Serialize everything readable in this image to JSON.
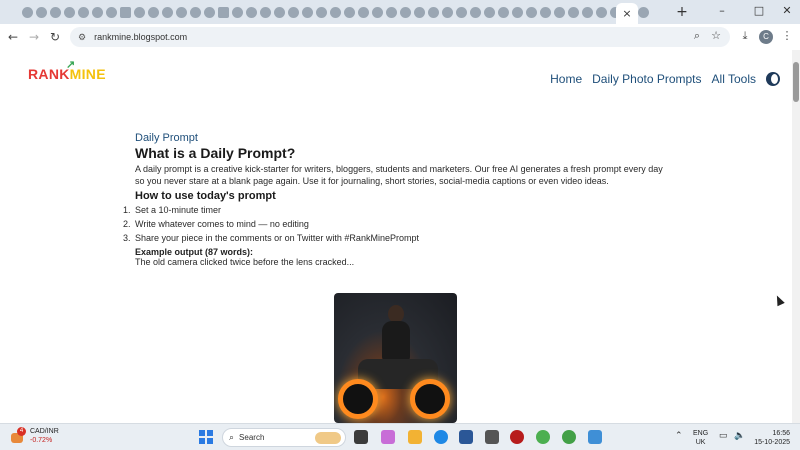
{
  "browser": {
    "url": "rankmine.blogspot.com",
    "active_tab_close": "×",
    "new_tab": "+",
    "profile_initial": "C",
    "window_controls": [
      "–",
      "□",
      "✕"
    ]
  },
  "site": {
    "logo": {
      "part1": "RANK",
      "part2": "MINE"
    },
    "nav": [
      "Home",
      "Daily Photo Prompts",
      "All Tools"
    ]
  },
  "article": {
    "kicker": "Daily Prompt",
    "title": "What is a Daily Prompt?",
    "intro": "A daily prompt is a creative kick-starter for writers, bloggers, students and marketers. Our free AI generates a fresh prompt every day so you never stare at a blank page again. Use it for journaling, short stories, social-media captions or even video ideas.",
    "how_title": "How to use today's prompt",
    "steps": [
      {
        "num": "1.",
        "text": "Set a 10-minute timer"
      },
      {
        "num": "2.",
        "text": "Write whatever comes to mind — no editing"
      },
      {
        "num": "3.",
        "text": "Share your piece in the comments or on Twitter with #RankMinePrompt"
      }
    ],
    "example_label": "Example output (87 words):",
    "example_text": "The old camera clicked twice before the lens cracked..."
  },
  "taskbar": {
    "ticker_symbol": "CAD/INR",
    "ticker_change": "-0.72%",
    "ticker_badge": "4",
    "search_placeholder": "Search",
    "lang_line1": "ENG",
    "lang_line2": "UK",
    "time": "16:56",
    "date": "15-10-2025"
  },
  "colors": {
    "nav_text": "#1f4f7a",
    "logo_red": "#e53935",
    "logo_yellow": "#f4c20d",
    "ticker_negative": "#c5221f"
  }
}
